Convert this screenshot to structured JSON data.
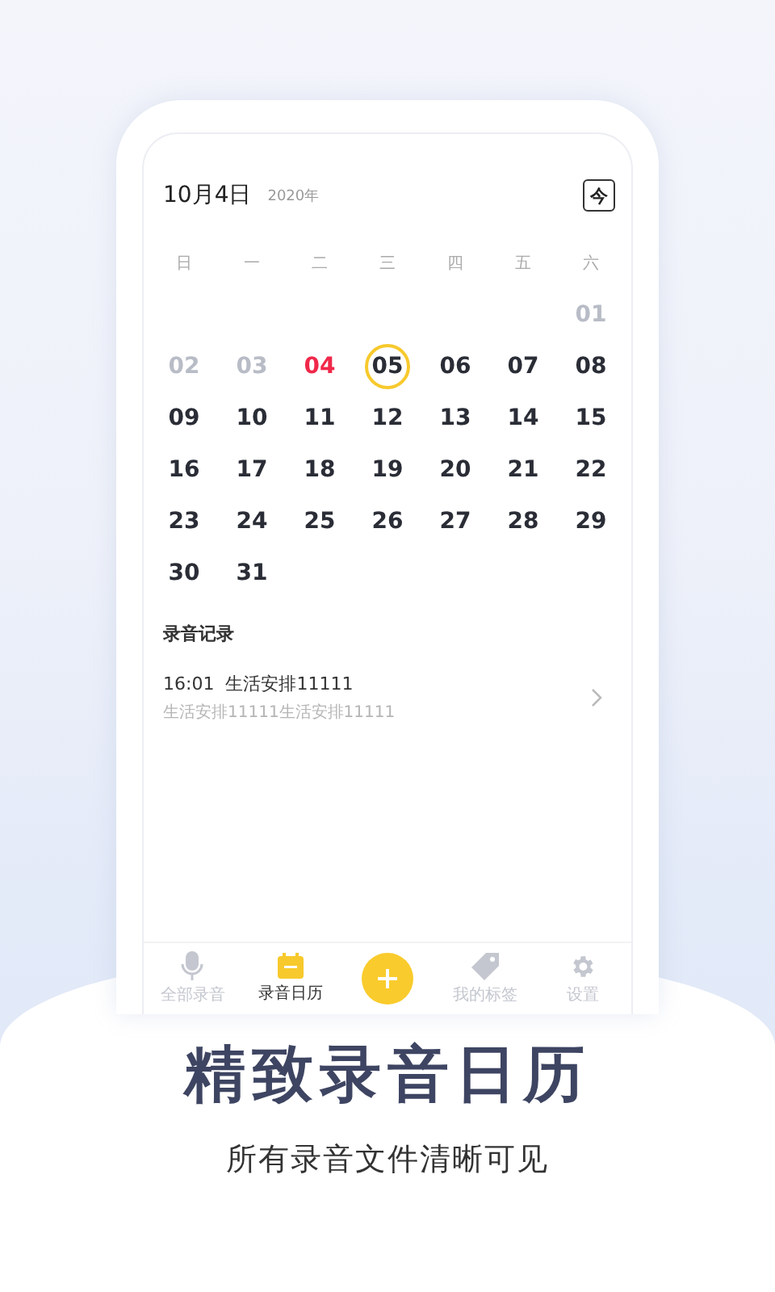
{
  "calendar": {
    "date_title": "10月4日",
    "year": "2020年",
    "today_button": "今",
    "weekdays": [
      "日",
      "一",
      "二",
      "三",
      "四",
      "五",
      "六"
    ],
    "days": [
      {
        "label": "01",
        "kind": "faded",
        "selected": false
      },
      {
        "label": "02",
        "kind": "faded",
        "selected": false
      },
      {
        "label": "03",
        "kind": "faded",
        "selected": false
      },
      {
        "label": "04",
        "kind": "red",
        "selected": false
      },
      {
        "label": "05",
        "kind": "normal",
        "selected": true
      },
      {
        "label": "06",
        "kind": "normal",
        "selected": false
      },
      {
        "label": "07",
        "kind": "normal",
        "selected": false
      },
      {
        "label": "08",
        "kind": "normal",
        "selected": false
      },
      {
        "label": "09",
        "kind": "normal",
        "selected": false
      },
      {
        "label": "10",
        "kind": "normal",
        "selected": false
      },
      {
        "label": "11",
        "kind": "normal",
        "selected": false
      },
      {
        "label": "12",
        "kind": "normal",
        "selected": false
      },
      {
        "label": "13",
        "kind": "normal",
        "selected": false
      },
      {
        "label": "14",
        "kind": "normal",
        "selected": false
      },
      {
        "label": "15",
        "kind": "normal",
        "selected": false
      },
      {
        "label": "16",
        "kind": "normal",
        "selected": false
      },
      {
        "label": "17",
        "kind": "normal",
        "selected": false
      },
      {
        "label": "18",
        "kind": "normal",
        "selected": false
      },
      {
        "label": "19",
        "kind": "normal",
        "selected": false
      },
      {
        "label": "20",
        "kind": "normal",
        "selected": false
      },
      {
        "label": "21",
        "kind": "normal",
        "selected": false
      },
      {
        "label": "22",
        "kind": "normal",
        "selected": false
      },
      {
        "label": "23",
        "kind": "normal",
        "selected": false
      },
      {
        "label": "24",
        "kind": "normal",
        "selected": false
      },
      {
        "label": "25",
        "kind": "normal",
        "selected": false
      },
      {
        "label": "26",
        "kind": "normal",
        "selected": false
      },
      {
        "label": "27",
        "kind": "normal",
        "selected": false
      },
      {
        "label": "28",
        "kind": "normal",
        "selected": false
      },
      {
        "label": "29",
        "kind": "normal",
        "selected": false
      },
      {
        "label": "30",
        "kind": "normal",
        "selected": false
      },
      {
        "label": "31",
        "kind": "normal",
        "selected": false
      }
    ]
  },
  "records": {
    "title": "录音记录",
    "items": [
      {
        "title": "16:01  生活安排11111",
        "detail": "生活安排11111生活安排11111"
      }
    ]
  },
  "tabs": [
    {
      "label": "全部录音",
      "kind": "mic",
      "selected": false
    },
    {
      "label": "录音日历",
      "kind": "calendar",
      "selected": true
    },
    {
      "label": "我的标签",
      "kind": "tag",
      "selected": false
    },
    {
      "label": "设置",
      "kind": "gear",
      "selected": false
    }
  ],
  "caption": {
    "title": "精致录音日历",
    "subtitle": "所有录音文件清晰可见"
  }
}
